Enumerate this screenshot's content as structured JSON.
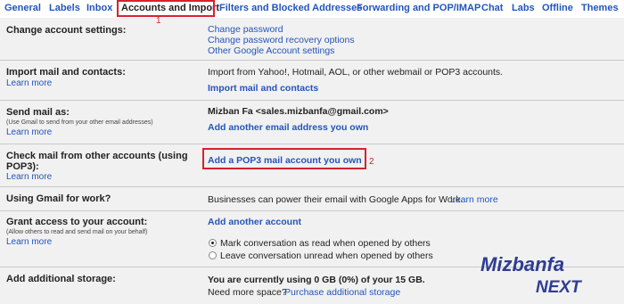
{
  "tabs": [
    "General",
    "Labels",
    "Inbox",
    "Accounts and Import",
    "Filters and Blocked Addresses",
    "Forwarding and POP/IMAP",
    "Chat",
    "Labs",
    "Offline",
    "Themes"
  ],
  "markers": {
    "one": "1",
    "two": "2"
  },
  "sections": {
    "change_settings": {
      "label": "Change account settings:",
      "links": [
        "Change password",
        "Change password recovery options",
        "Other Google Account settings"
      ]
    },
    "import": {
      "label": "Import mail and contacts:",
      "learn": "Learn more",
      "text": "Import from Yahoo!, Hotmail, AOL, or other webmail or POP3 accounts.",
      "action": "Import mail and contacts"
    },
    "send_as": {
      "label": "Send mail as:",
      "sub": "(Use Gmail to send from your other email addresses)",
      "learn": "Learn more",
      "address": "Mizban Fa <sales.mizbanfa@gmail.com>",
      "action": "Add another email address you own"
    },
    "check_mail": {
      "label1": "Check mail from other accounts (using",
      "label2": "POP3):",
      "learn": "Learn more",
      "action": "Add a POP3 mail account you own"
    },
    "work": {
      "label": "Using Gmail for work?",
      "text": "Businesses can power their email with Google Apps for Work.",
      "learn": "Learn more"
    },
    "grant": {
      "label": "Grant access to your account:",
      "sub": "(Allow others to read and send mail on your behalf)",
      "learn": "Learn more",
      "action": "Add another account",
      "opt1": "Mark conversation as read when opened by others",
      "opt2": "Leave conversation unread when opened by others"
    },
    "storage": {
      "label": "Add additional storage:",
      "text": "You are currently using 0 GB (0%) of your 15 GB.",
      "need": "Need more space?",
      "link": "Purchase additional storage"
    }
  },
  "logo": {
    "line1": "Mizbanfa",
    "line2": "NEXT"
  },
  "colors": {
    "accent": "#d8202f",
    "link": "#2255bb",
    "logo": "#2f3d91"
  }
}
